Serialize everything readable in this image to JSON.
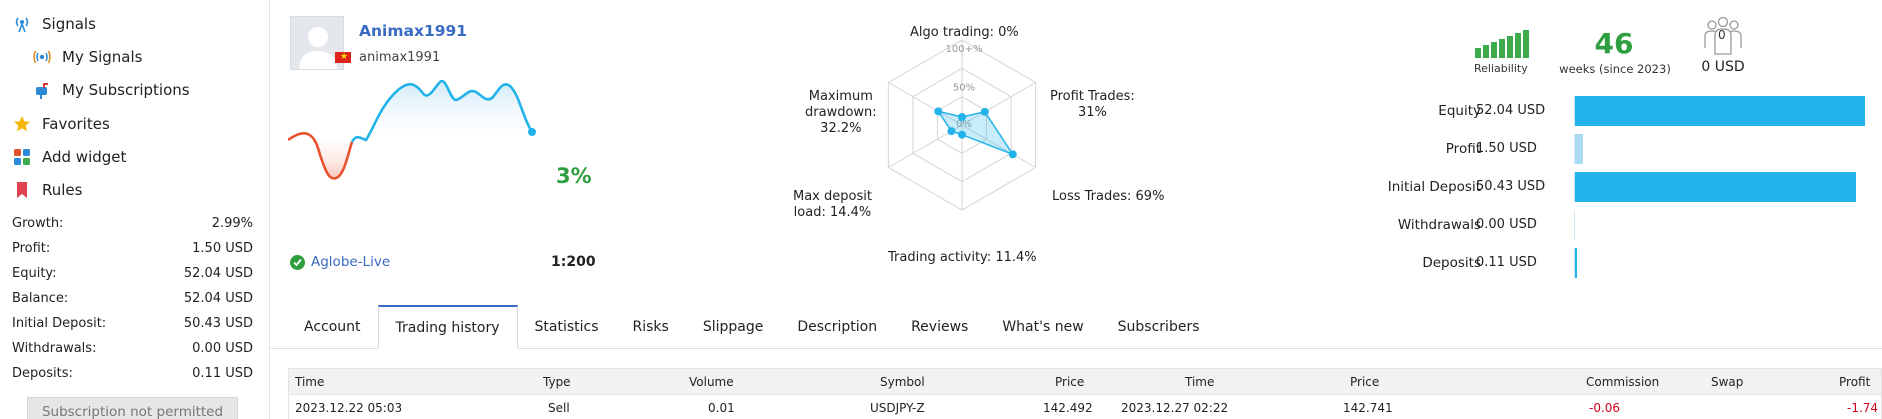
{
  "sidebar": {
    "nav": [
      {
        "label": "Signals",
        "icon": "signal-antenna-icon"
      },
      {
        "label": "My Signals",
        "icon": "broadcast-icon"
      },
      {
        "label": "My Subscriptions",
        "icon": "mailbox-icon"
      },
      {
        "label": "Favorites",
        "icon": "star-icon"
      },
      {
        "label": "Add widget",
        "icon": "widget-grid-icon"
      },
      {
        "label": "Rules",
        "icon": "bookmark-icon"
      }
    ],
    "stats": [
      {
        "label": "Growth:",
        "value": "2.99%"
      },
      {
        "label": "Profit:",
        "value": "1.50 USD"
      },
      {
        "label": "Equity:",
        "value": "52.04 USD"
      },
      {
        "label": "Balance:",
        "value": "52.04 USD"
      },
      {
        "label": "Initial Deposit:",
        "value": "50.43 USD"
      },
      {
        "label": "Withdrawals:",
        "value": "0.00 USD"
      },
      {
        "label": "Deposits:",
        "value": "0.11 USD"
      }
    ],
    "subscribe_button": "Subscription not permitted"
  },
  "profile": {
    "name": "Animax1991",
    "login": "animax1991",
    "growth": "3%",
    "broker": "Aglobe-Live",
    "leverage": "1:200",
    "flag_color": "#da251d"
  },
  "radar": {
    "labels": {
      "algo": "Algo trading: 0%",
      "profit_trades": "Profit Trades:",
      "profit_trades_val": "31%",
      "loss_trades": "Loss Trades: 69%",
      "trading_activity": "Trading activity: 11.4%",
      "max_deposit_load_1": "Max deposit",
      "max_deposit_load_2": "load: 14.4%",
      "max_drawdown_1": "Maximum",
      "max_drawdown_2": "drawdown:",
      "max_drawdown_3": "32.2%"
    },
    "ticks": [
      "100+%",
      "50%",
      "0%"
    ],
    "values": {
      "algo_trading": 0,
      "profit_trades": 31,
      "loss_trades": 69,
      "trading_activity": 11.4,
      "max_deposit_load": 14.4,
      "max_drawdown": 32.2
    }
  },
  "summary": {
    "reliability_label": "Reliability",
    "weeks": "46",
    "weeks_label": "weeks (since 2023)",
    "subscribers_count": "0",
    "subscribers_usd": "0 USD",
    "accent": "#2e9e3f"
  },
  "balance_bars": [
    {
      "label": "Equity",
      "value": "52.04 USD",
      "amount": 52.04,
      "color": "#22b3ea"
    },
    {
      "label": "Profit",
      "value": "1.50 USD",
      "amount": 1.5,
      "color": "#a9dcf4"
    },
    {
      "label": "Initial Deposit",
      "value": "50.43 USD",
      "amount": 50.43,
      "color": "#22b3ea"
    },
    {
      "label": "Withdrawals",
      "value": "0.00 USD",
      "amount": 0.0,
      "color": "#22b3ea"
    },
    {
      "label": "Deposits",
      "value": "0.11 USD",
      "amount": 0.11,
      "color": "#22b3ea"
    }
  ],
  "tabs": [
    {
      "label": "Account",
      "active": false
    },
    {
      "label": "Trading history",
      "active": true
    },
    {
      "label": "Statistics",
      "active": false
    },
    {
      "label": "Risks",
      "active": false
    },
    {
      "label": "Slippage",
      "active": false
    },
    {
      "label": "Description",
      "active": false
    },
    {
      "label": "Reviews",
      "active": false
    },
    {
      "label": "What's new",
      "active": false
    },
    {
      "label": "Subscribers",
      "active": false
    }
  ],
  "history": {
    "columns": [
      "Time",
      "Type",
      "Volume",
      "Symbol",
      "Price",
      "Time",
      "Price",
      "Commission",
      "Swap",
      "Profit"
    ],
    "rows": [
      [
        "2023.12.22 05:03",
        "Sell",
        "0.01",
        "USDJPY-Z",
        "142.492",
        "2023.12.27 02:22",
        "142.741",
        "-0.06",
        "",
        "-1.74"
      ]
    ]
  }
}
